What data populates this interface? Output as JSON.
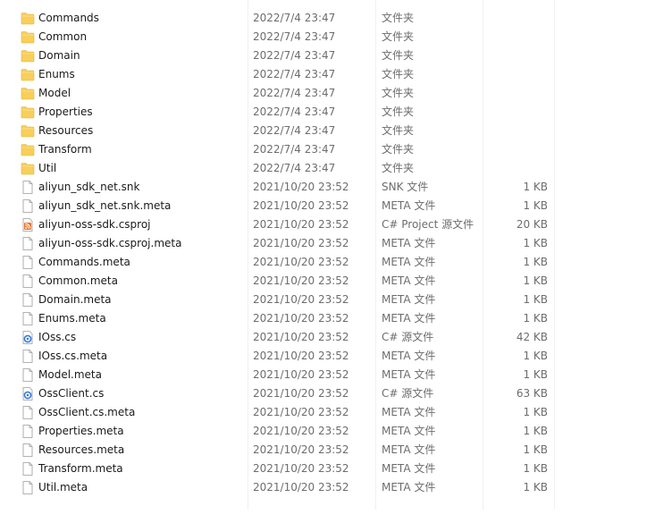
{
  "colors": {
    "folder": "#f8cf5b",
    "text": "#1a1a1a",
    "meta_text": "#6d6d6d",
    "rss_orange": "#e8732a",
    "cs_blue": "#3a7bd5"
  },
  "files": [
    {
      "name": "Commands",
      "date": "2022/7/4 23:47",
      "type": "文件夹",
      "size": "",
      "icon": "folder-icon"
    },
    {
      "name": "Common",
      "date": "2022/7/4 23:47",
      "type": "文件夹",
      "size": "",
      "icon": "folder-icon"
    },
    {
      "name": "Domain",
      "date": "2022/7/4 23:47",
      "type": "文件夹",
      "size": "",
      "icon": "folder-icon"
    },
    {
      "name": "Enums",
      "date": "2022/7/4 23:47",
      "type": "文件夹",
      "size": "",
      "icon": "folder-icon"
    },
    {
      "name": "Model",
      "date": "2022/7/4 23:47",
      "type": "文件夹",
      "size": "",
      "icon": "folder-icon"
    },
    {
      "name": "Properties",
      "date": "2022/7/4 23:47",
      "type": "文件夹",
      "size": "",
      "icon": "folder-icon"
    },
    {
      "name": "Resources",
      "date": "2022/7/4 23:47",
      "type": "文件夹",
      "size": "",
      "icon": "folder-icon"
    },
    {
      "name": "Transform",
      "date": "2022/7/4 23:47",
      "type": "文件夹",
      "size": "",
      "icon": "folder-icon"
    },
    {
      "name": "Util",
      "date": "2022/7/4 23:47",
      "type": "文件夹",
      "size": "",
      "icon": "folder-icon"
    },
    {
      "name": "aliyun_sdk_net.snk",
      "date": "2021/10/20 23:52",
      "type": "SNK 文件",
      "size": "1 KB",
      "icon": "file-icon"
    },
    {
      "name": "aliyun_sdk_net.snk.meta",
      "date": "2021/10/20 23:52",
      "type": "META 文件",
      "size": "1 KB",
      "icon": "file-icon"
    },
    {
      "name": "aliyun-oss-sdk.csproj",
      "date": "2021/10/20 23:52",
      "type": "C# Project 源文件",
      "size": "20 KB",
      "icon": "csproj-icon"
    },
    {
      "name": "aliyun-oss-sdk.csproj.meta",
      "date": "2021/10/20 23:52",
      "type": "META 文件",
      "size": "1 KB",
      "icon": "file-icon"
    },
    {
      "name": "Commands.meta",
      "date": "2021/10/20 23:52",
      "type": "META 文件",
      "size": "1 KB",
      "icon": "file-icon"
    },
    {
      "name": "Common.meta",
      "date": "2021/10/20 23:52",
      "type": "META 文件",
      "size": "1 KB",
      "icon": "file-icon"
    },
    {
      "name": "Domain.meta",
      "date": "2021/10/20 23:52",
      "type": "META 文件",
      "size": "1 KB",
      "icon": "file-icon"
    },
    {
      "name": "Enums.meta",
      "date": "2021/10/20 23:52",
      "type": "META 文件",
      "size": "1 KB",
      "icon": "file-icon"
    },
    {
      "name": "IOss.cs",
      "date": "2021/10/20 23:52",
      "type": "C# 源文件",
      "size": "42 KB",
      "icon": "csharp-file-icon"
    },
    {
      "name": "IOss.cs.meta",
      "date": "2021/10/20 23:52",
      "type": "META 文件",
      "size": "1 KB",
      "icon": "file-icon"
    },
    {
      "name": "Model.meta",
      "date": "2021/10/20 23:52",
      "type": "META 文件",
      "size": "1 KB",
      "icon": "file-icon"
    },
    {
      "name": "OssClient.cs",
      "date": "2021/10/20 23:52",
      "type": "C# 源文件",
      "size": "63 KB",
      "icon": "csharp-file-icon"
    },
    {
      "name": "OssClient.cs.meta",
      "date": "2021/10/20 23:52",
      "type": "META 文件",
      "size": "1 KB",
      "icon": "file-icon"
    },
    {
      "name": "Properties.meta",
      "date": "2021/10/20 23:52",
      "type": "META 文件",
      "size": "1 KB",
      "icon": "file-icon"
    },
    {
      "name": "Resources.meta",
      "date": "2021/10/20 23:52",
      "type": "META 文件",
      "size": "1 KB",
      "icon": "file-icon"
    },
    {
      "name": "Transform.meta",
      "date": "2021/10/20 23:52",
      "type": "META 文件",
      "size": "1 KB",
      "icon": "file-icon"
    },
    {
      "name": "Util.meta",
      "date": "2021/10/20 23:52",
      "type": "META 文件",
      "size": "1 KB",
      "icon": "file-icon"
    }
  ]
}
